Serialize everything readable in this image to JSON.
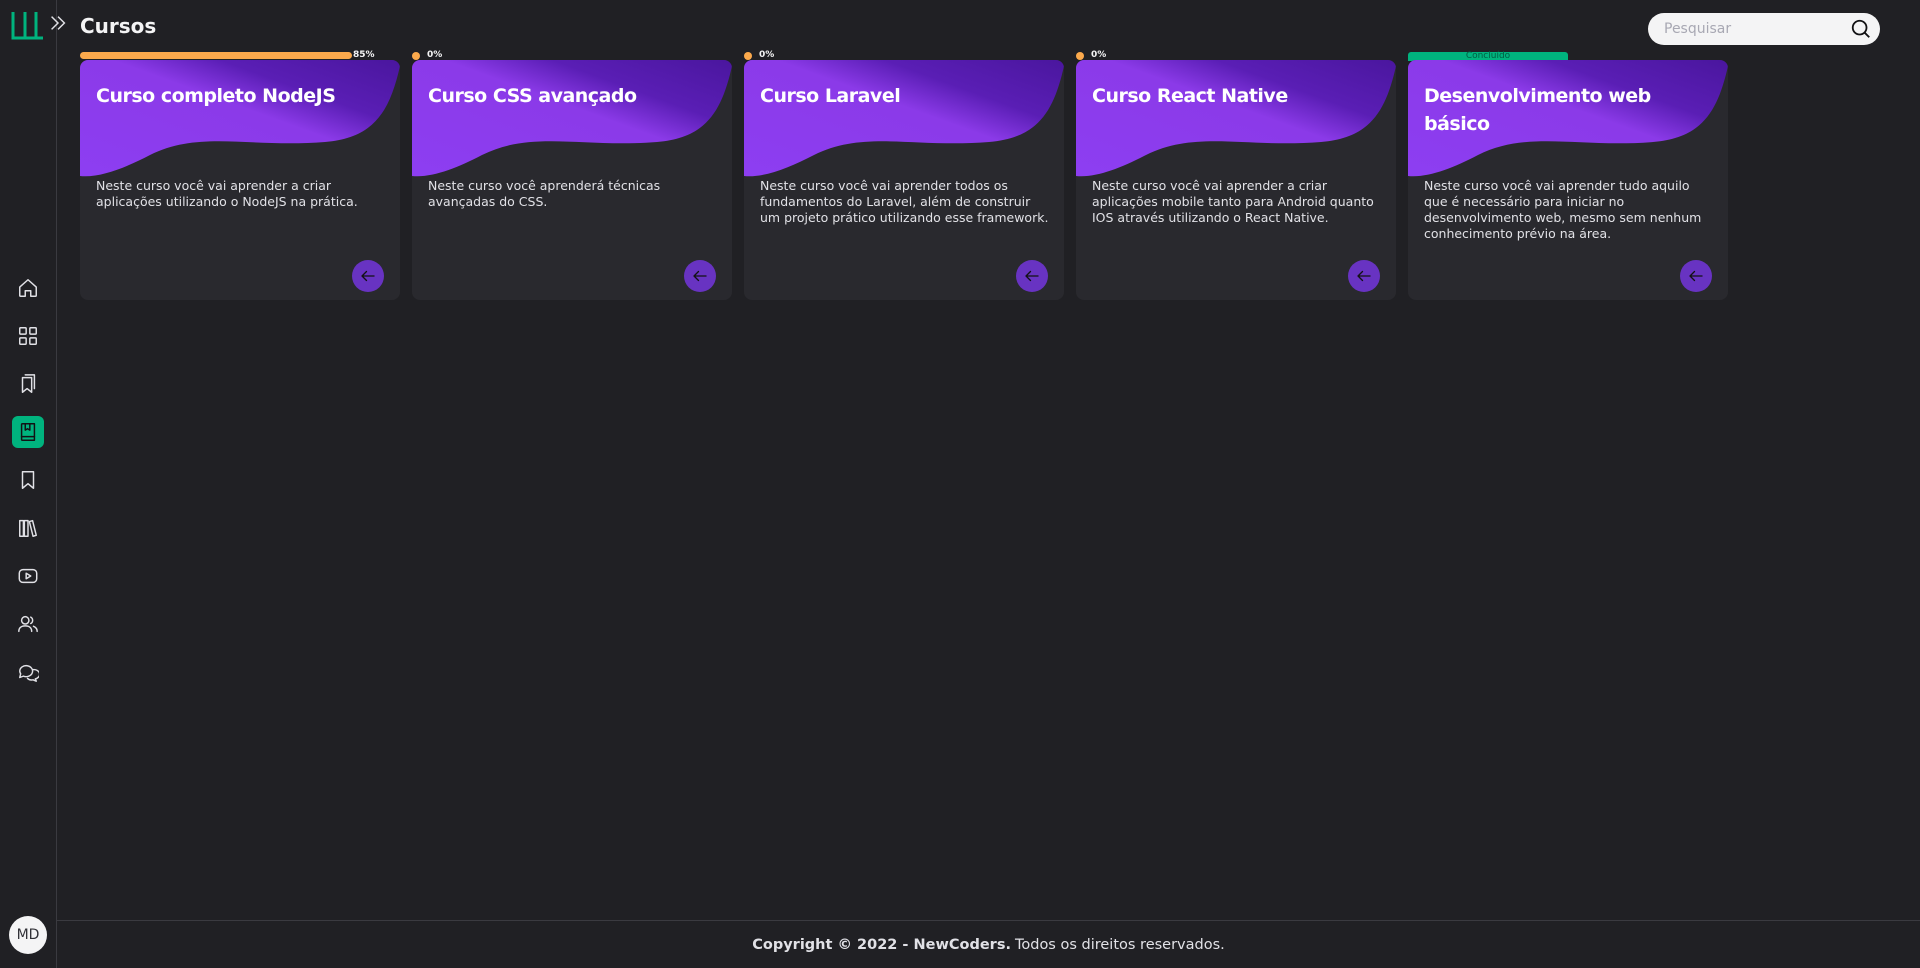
{
  "header": {
    "title": "Cursos",
    "search_placeholder": "Pesquisar"
  },
  "sidebar": {
    "logo": "logo-icon",
    "items": [
      {
        "name": "home",
        "icon": "home-icon",
        "active": false
      },
      {
        "name": "dashboard",
        "icon": "grid-icon",
        "active": false
      },
      {
        "name": "books",
        "icon": "bookmarks-icon",
        "active": false
      },
      {
        "name": "courses",
        "icon": "book-icon",
        "active": true
      },
      {
        "name": "saved",
        "icon": "bookmark-icon",
        "active": false
      },
      {
        "name": "library",
        "icon": "library-icon",
        "active": false
      },
      {
        "name": "videos",
        "icon": "youtube-icon",
        "active": false
      },
      {
        "name": "community",
        "icon": "users-icon",
        "active": false
      },
      {
        "name": "chat",
        "icon": "chat-icon",
        "active": false
      }
    ],
    "avatar_initials": "MD"
  },
  "courses": [
    {
      "progress_label": "85%",
      "progress": 0.85,
      "title": "Curso completo NodeJS",
      "description": "Neste curso você vai aprender a criar aplicações utilizando o NodeJS na prática."
    },
    {
      "progress_label": "0%",
      "progress": 0,
      "title": "Curso CSS avançado",
      "description": "Neste curso você aprenderá técnicas avançadas do CSS."
    },
    {
      "progress_label": "0%",
      "progress": 0,
      "title": "Curso Laravel",
      "description": "Neste curso você vai aprender todos os fundamentos do Laravel, além de construir um projeto prático utilizando esse framework."
    },
    {
      "progress_label": "0%",
      "progress": 0,
      "title": "Curso React Native",
      "description": "Neste curso você vai aprender a criar aplicações mobile tanto para Android quanto IOS através utilizando o React Native."
    },
    {
      "status_label": "Concluído",
      "progress": 1,
      "title": "Desenvolvimento web básico",
      "description": "Neste curso você vai aprender tudo aquilo que é necessário para iniciar no desenvolvimento web, mesmo sem nenhum conhecimento prévio na área."
    }
  ],
  "footer": {
    "copyright": "Copyright © 2022 - NewCoders.",
    "rights": "Todos os direitos reservados."
  },
  "colors": {
    "background": "#202024",
    "card": "#29292e",
    "accent_green": "#00b37e",
    "accent_purple": "#8257e5",
    "progress_orange": "#fba94c"
  }
}
